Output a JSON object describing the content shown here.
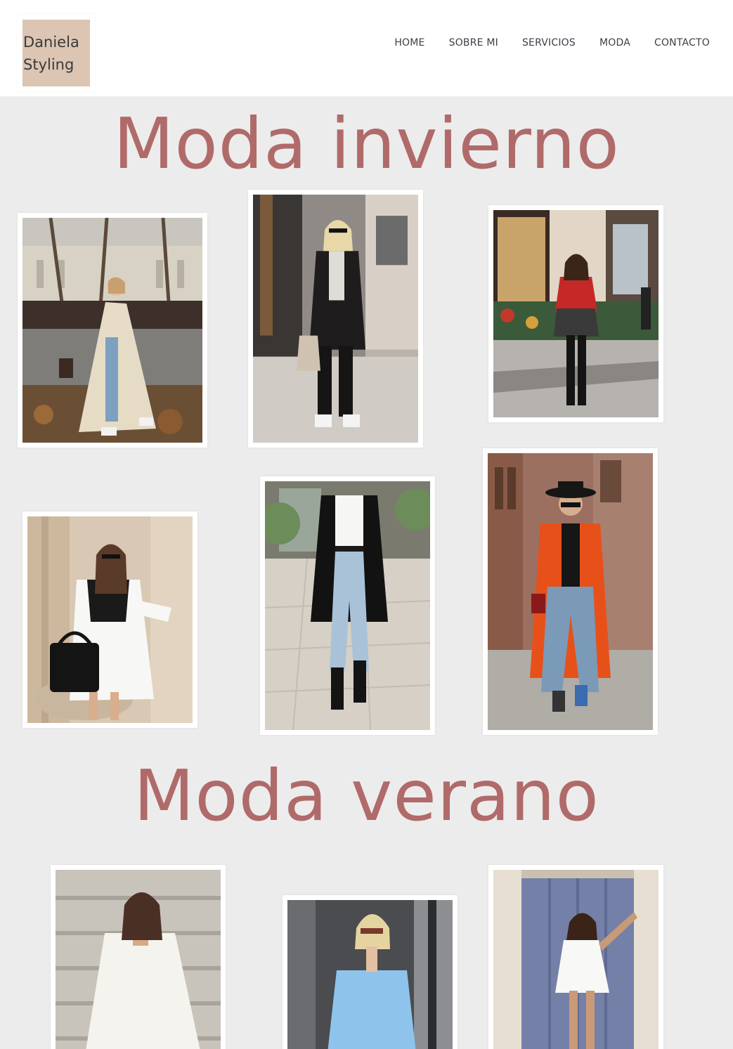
{
  "brand": {
    "line1": "Daniela",
    "line2": "Styling"
  },
  "nav": [
    {
      "label": "HOME"
    },
    {
      "label": "SOBRE MI"
    },
    {
      "label": "SERVICIOS"
    },
    {
      "label": "MODA"
    },
    {
      "label": "CONTACTO"
    }
  ],
  "sections": {
    "winter_title": "Moda invierno",
    "summer_title": "Moda verano"
  },
  "colors": {
    "accent_title": "#b06a6a",
    "logo_bg": "#dcc5b3",
    "page_bg": "#ececec"
  }
}
